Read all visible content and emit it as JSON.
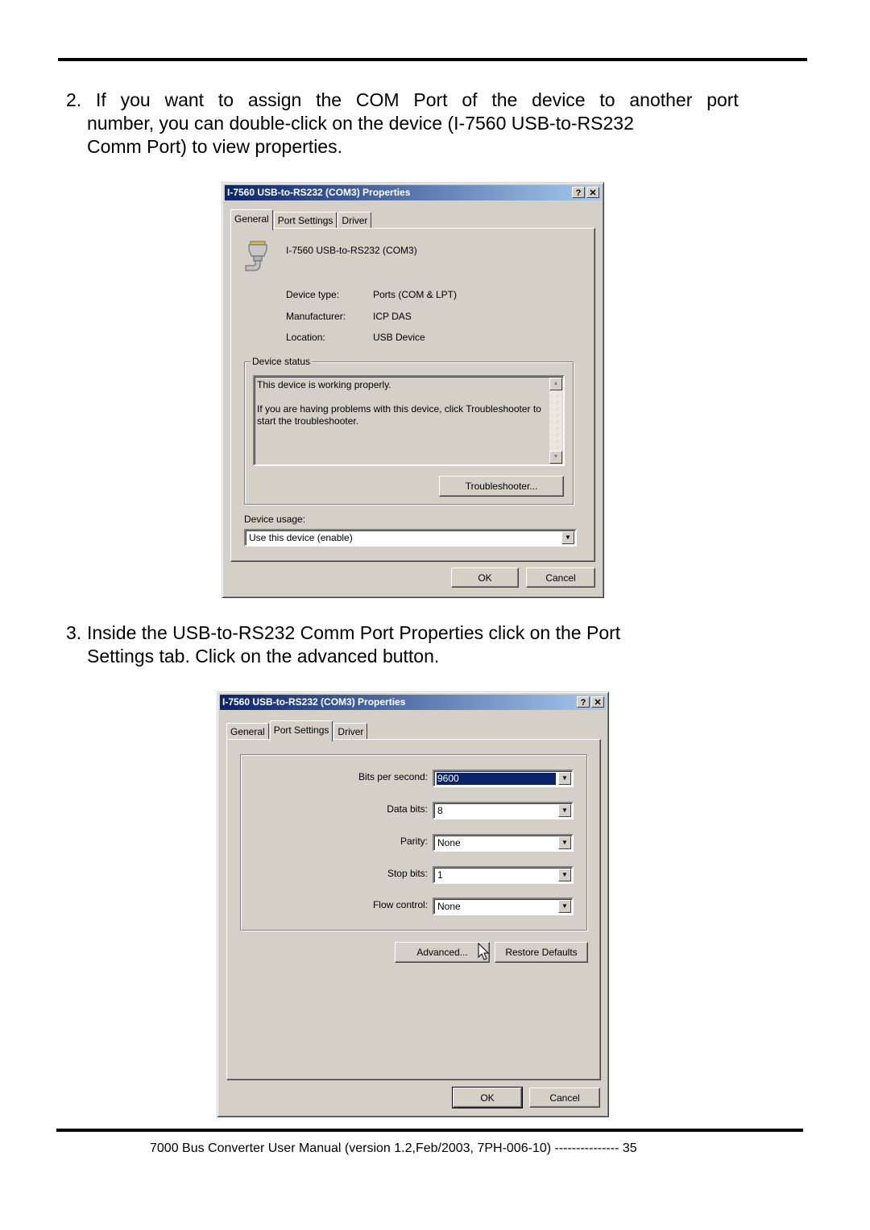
{
  "page": {
    "step2": {
      "number": "2.",
      "line1_words": [
        "If",
        "you",
        "want",
        "to",
        "assign",
        "the",
        "COM",
        "Port",
        "of",
        "the",
        "device",
        "to",
        "another",
        "port"
      ],
      "line2": "number, you can double-click on the device (I-7560 USB-to-RS232",
      "line3": "Comm Port) to view properties."
    },
    "step3": {
      "number": "3.",
      "line1": "Inside the USB-to-RS232 Comm Port Properties click on the Port",
      "line2": "Settings tab. Click on the advanced button."
    },
    "footer": "7000 Bus Converter User Manual (version 1.2,Feb/2003, 7PH-006-10)  --------------- 35"
  },
  "dialog1": {
    "title": "I-7560 USB-to-RS232 (COM3) Properties",
    "help_btn": "?",
    "close_btn": "✕",
    "tabs": [
      {
        "label": "General",
        "active": true
      },
      {
        "label": "Port Settings",
        "active": false
      },
      {
        "label": "Driver",
        "active": false
      }
    ],
    "device_name": "I-7560 USB-to-RS232 (COM3)",
    "device_icon": "serial-port-icon",
    "props": [
      {
        "label": "Device type:",
        "value": "Ports (COM & LPT)"
      },
      {
        "label": "Manufacturer:",
        "value": "ICP DAS"
      },
      {
        "label": "Location:",
        "value": "USB Device"
      }
    ],
    "status_group": "Device status",
    "status_line1": "This device is working properly.",
    "status_line2": "If you are having problems with this device, click Troubleshooter to start the troubleshooter.",
    "troubleshooter_btn": "Troubleshooter...",
    "usage_label": "Device usage:",
    "usage_value": "Use this device (enable)",
    "ok": "OK",
    "cancel": "Cancel"
  },
  "dialog2": {
    "title": "I-7560 USB-to-RS232 (COM3) Properties",
    "help_btn": "?",
    "close_btn": "✕",
    "tabs": [
      {
        "label": "General",
        "active": false
      },
      {
        "label": "Port Settings",
        "active": true
      },
      {
        "label": "Driver",
        "active": false
      }
    ],
    "fields": [
      {
        "label": "Bits per second:",
        "value": "9600",
        "selected": true
      },
      {
        "label": "Data bits:",
        "value": "8",
        "selected": false
      },
      {
        "label": "Parity:",
        "value": "None",
        "selected": false
      },
      {
        "label": "Stop bits:",
        "value": "1",
        "selected": false
      },
      {
        "label": "Flow control:",
        "value": "None",
        "selected": false
      }
    ],
    "advanced_btn": "Advanced...",
    "restore_btn": "Restore Defaults",
    "ok": "OK",
    "cancel": "Cancel"
  }
}
